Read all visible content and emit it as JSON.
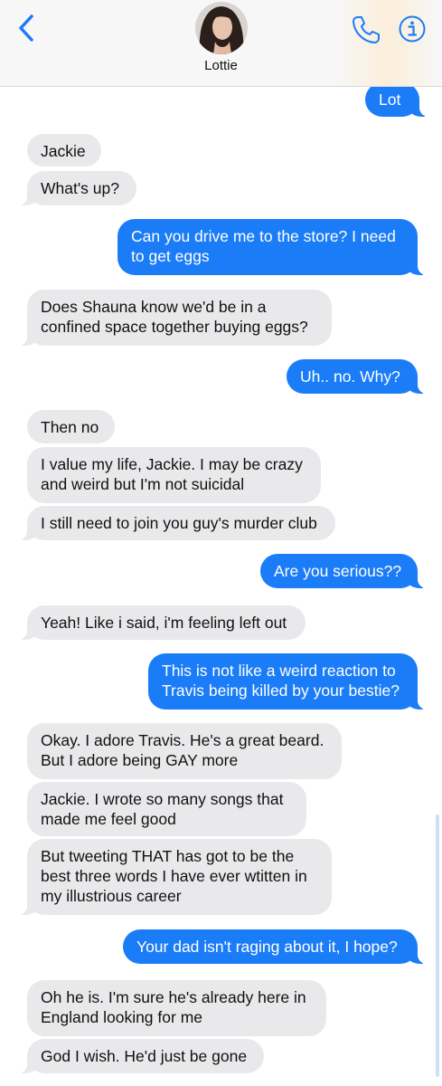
{
  "header": {
    "contact_name": "Lottie",
    "accent_color": "#1b7cf7",
    "icons": {
      "back": "chevron-left-icon",
      "phone": "phone-icon",
      "info": "info-icon"
    }
  },
  "messages": [
    {
      "from": "me",
      "text": "Lot"
    },
    {
      "from": "them",
      "text": "Jackie"
    },
    {
      "from": "them",
      "text": "What's up?"
    },
    {
      "from": "me",
      "text": "Can you drive me to the store? I need\nto get eggs"
    },
    {
      "from": "them",
      "text": "Does Shauna know we'd be in a\nconfined space together buying eggs?"
    },
    {
      "from": "me",
      "text": "Uh.. no. Why?"
    },
    {
      "from": "them",
      "text": "Then no"
    },
    {
      "from": "them",
      "text": "I value my life, Jackie. I may be crazy\nand weird but I'm not suicidal"
    },
    {
      "from": "them",
      "text": "I still need to join you guy's murder club"
    },
    {
      "from": "me",
      "text": "Are you serious??"
    },
    {
      "from": "them",
      "text": "Yeah! Like i said, i'm feeling left out"
    },
    {
      "from": "me",
      "text": "This is not like a weird reaction to\nTravis being killed by your bestie?"
    },
    {
      "from": "them",
      "text": "Okay. I adore Travis. He's a great beard.\nBut I adore being GAY more"
    },
    {
      "from": "them",
      "text": "Jackie. I wrote so many songs that\nmade me feel good"
    },
    {
      "from": "them",
      "text": "But tweeting THAT has got to be the\nbest three words I have ever wtitten in\nmy illustrious career"
    },
    {
      "from": "me",
      "text": "Your dad isn't raging about it, I hope?"
    },
    {
      "from": "them",
      "text": "Oh he is. I'm sure he's already here in\nEngland looking for me"
    },
    {
      "from": "them",
      "text": "God I wish. He'd just be gone"
    }
  ]
}
